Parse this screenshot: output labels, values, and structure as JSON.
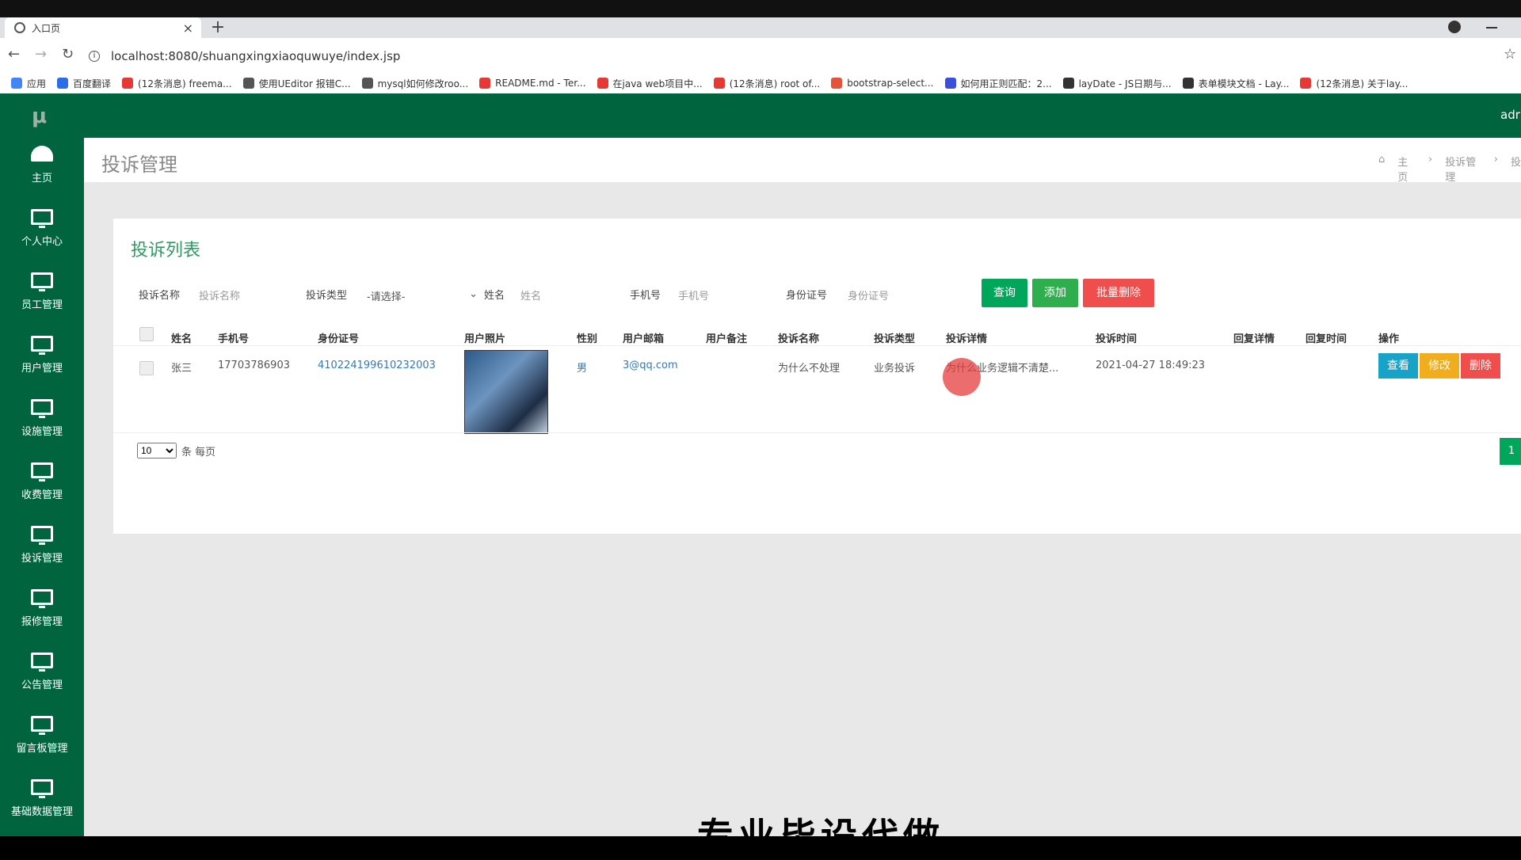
{
  "browser": {
    "tab_title": "入口页",
    "url": "localhost:8080/shuangxingxiaoquwuye/index.jsp",
    "bookmarks": [
      {
        "label": "应用",
        "color": "#4285f4"
      },
      {
        "label": "百度翻译",
        "color": "#2b6de8"
      },
      {
        "label": "(12条消息) freema...",
        "color": "#e53935"
      },
      {
        "label": "使用UEditor 报错C...",
        "color": "#555555"
      },
      {
        "label": "mysql如何修改roo...",
        "color": "#555555"
      },
      {
        "label": "README.md - Ter...",
        "color": "#e53935"
      },
      {
        "label": "在java web项目中...",
        "color": "#e53935"
      },
      {
        "label": "(12条消息) root of...",
        "color": "#e53935"
      },
      {
        "label": "bootstrap-select...",
        "color": "#e5533a"
      },
      {
        "label": "如何用正则匹配：2...",
        "color": "#3a50d9"
      },
      {
        "label": "layDate - JS日期与...",
        "color": "#333333"
      },
      {
        "label": "表单模块文档 - Lay...",
        "color": "#333333"
      },
      {
        "label": "(12条消息) 关于lay...",
        "color": "#e53935"
      }
    ]
  },
  "header": {
    "logo": "μ",
    "user": "adr"
  },
  "sidebar": {
    "items": [
      {
        "label": "主页"
      },
      {
        "label": "个人中心"
      },
      {
        "label": "员工管理"
      },
      {
        "label": "用户管理"
      },
      {
        "label": "设施管理"
      },
      {
        "label": "收费管理"
      },
      {
        "label": "投诉管理"
      },
      {
        "label": "报修管理"
      },
      {
        "label": "公告管理"
      },
      {
        "label": "留言板管理"
      },
      {
        "label": "基础数据管理"
      }
    ]
  },
  "page": {
    "title": "投诉管理",
    "breadcrumb": [
      "主页",
      "›",
      "投诉管理",
      "›",
      "投"
    ]
  },
  "panel": {
    "title": "投诉列表",
    "filters": {
      "complaint_name_label": "投诉名称",
      "complaint_name_placeholder": "投诉名称",
      "type_label": "投诉类型",
      "type_value": "-请选择-",
      "name_label": "姓名",
      "name_placeholder": "姓名",
      "phone_label": "手机号",
      "phone_placeholder": "手机号",
      "id_label": "身份证号",
      "id_placeholder": "身份证号"
    },
    "buttons": {
      "query": "查询",
      "add": "添加",
      "batch_delete": "批量删除"
    },
    "columns": [
      "姓名",
      "手机号",
      "身份证号",
      "用户照片",
      "性别",
      "用户邮箱",
      "用户备注",
      "投诉名称",
      "投诉类型",
      "投诉详情",
      "投诉时间",
      "回复详情",
      "回复时间",
      "操作"
    ],
    "rows": [
      {
        "name": "张三",
        "phone": "17703786903",
        "id_number": "410224199610232003",
        "gender": "男",
        "email": "3@qq.com",
        "remark": "",
        "complaint_name": "为什么不处理",
        "complaint_type": "业务投诉",
        "complaint_detail": "为什么业务逻辑不清楚...",
        "complaint_time": "2021-04-27 18:49:23",
        "reply_detail": "",
        "reply_time": "",
        "actions": {
          "view": "查看",
          "edit": "修改",
          "delete": "删除"
        }
      }
    ],
    "pagination": {
      "per_page_value": "10",
      "per_page_suffix": "条 每页",
      "current_page": "1"
    }
  },
  "overlay": {
    "subtitle": "专业毕设代做"
  },
  "colors": {
    "brand_green": "#00643f",
    "query_btn": "#00a65a",
    "add_btn": "#2eae4c",
    "delete_btn": "#f04d4d",
    "view_btn": "#17a2c8",
    "edit_btn": "#f0ad1e",
    "row_delete_btn": "#f04d4d"
  }
}
